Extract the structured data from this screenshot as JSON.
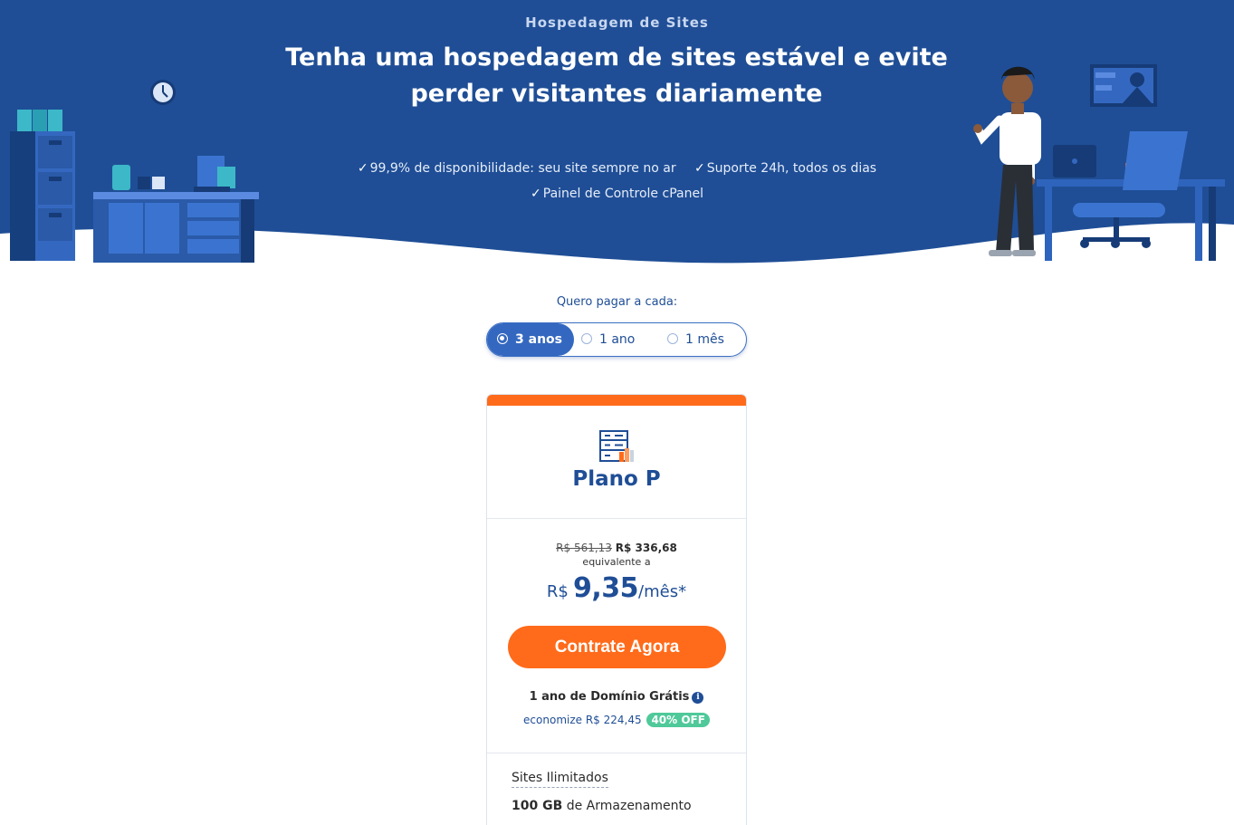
{
  "hero": {
    "eyebrow": "Hospedagem de Sites",
    "headline": "Tenha uma hospedagem de sites estável e evite perder visitantes diariamente",
    "features": [
      "99,9% de disponibilidade: seu site sempre no ar",
      "Suporte 24h, todos os dias",
      "Painel de Controle cPanel"
    ]
  },
  "billing": {
    "label": "Quero pagar a cada:",
    "options": [
      "3 anos",
      "1 ano",
      "1 mês"
    ],
    "selected": "3 anos"
  },
  "plan": {
    "name": "Plano P",
    "old_price": "R$ 561,13",
    "new_total": "R$ 336,68",
    "equivalent_label": "equivalente a",
    "currency": "R$",
    "monthly_amount": "9,35",
    "per_period": "/mês*",
    "cta_label": "Contrate Agora",
    "domain_offer": "1 ano de Domínio Grátis",
    "info_icon": "i",
    "saving_text": "economize R$ 224,45",
    "discount_badge": "40% OFF",
    "features": {
      "sites": "Sites Ilimitados",
      "storage_amount": "100 GB",
      "storage_label": "de Armazenamento"
    }
  },
  "colors": {
    "hero_bg": "#1f4e96",
    "accent_orange": "#ff6b1a",
    "badge_green": "#4fc99a",
    "brand_blue": "#1f4e96"
  }
}
